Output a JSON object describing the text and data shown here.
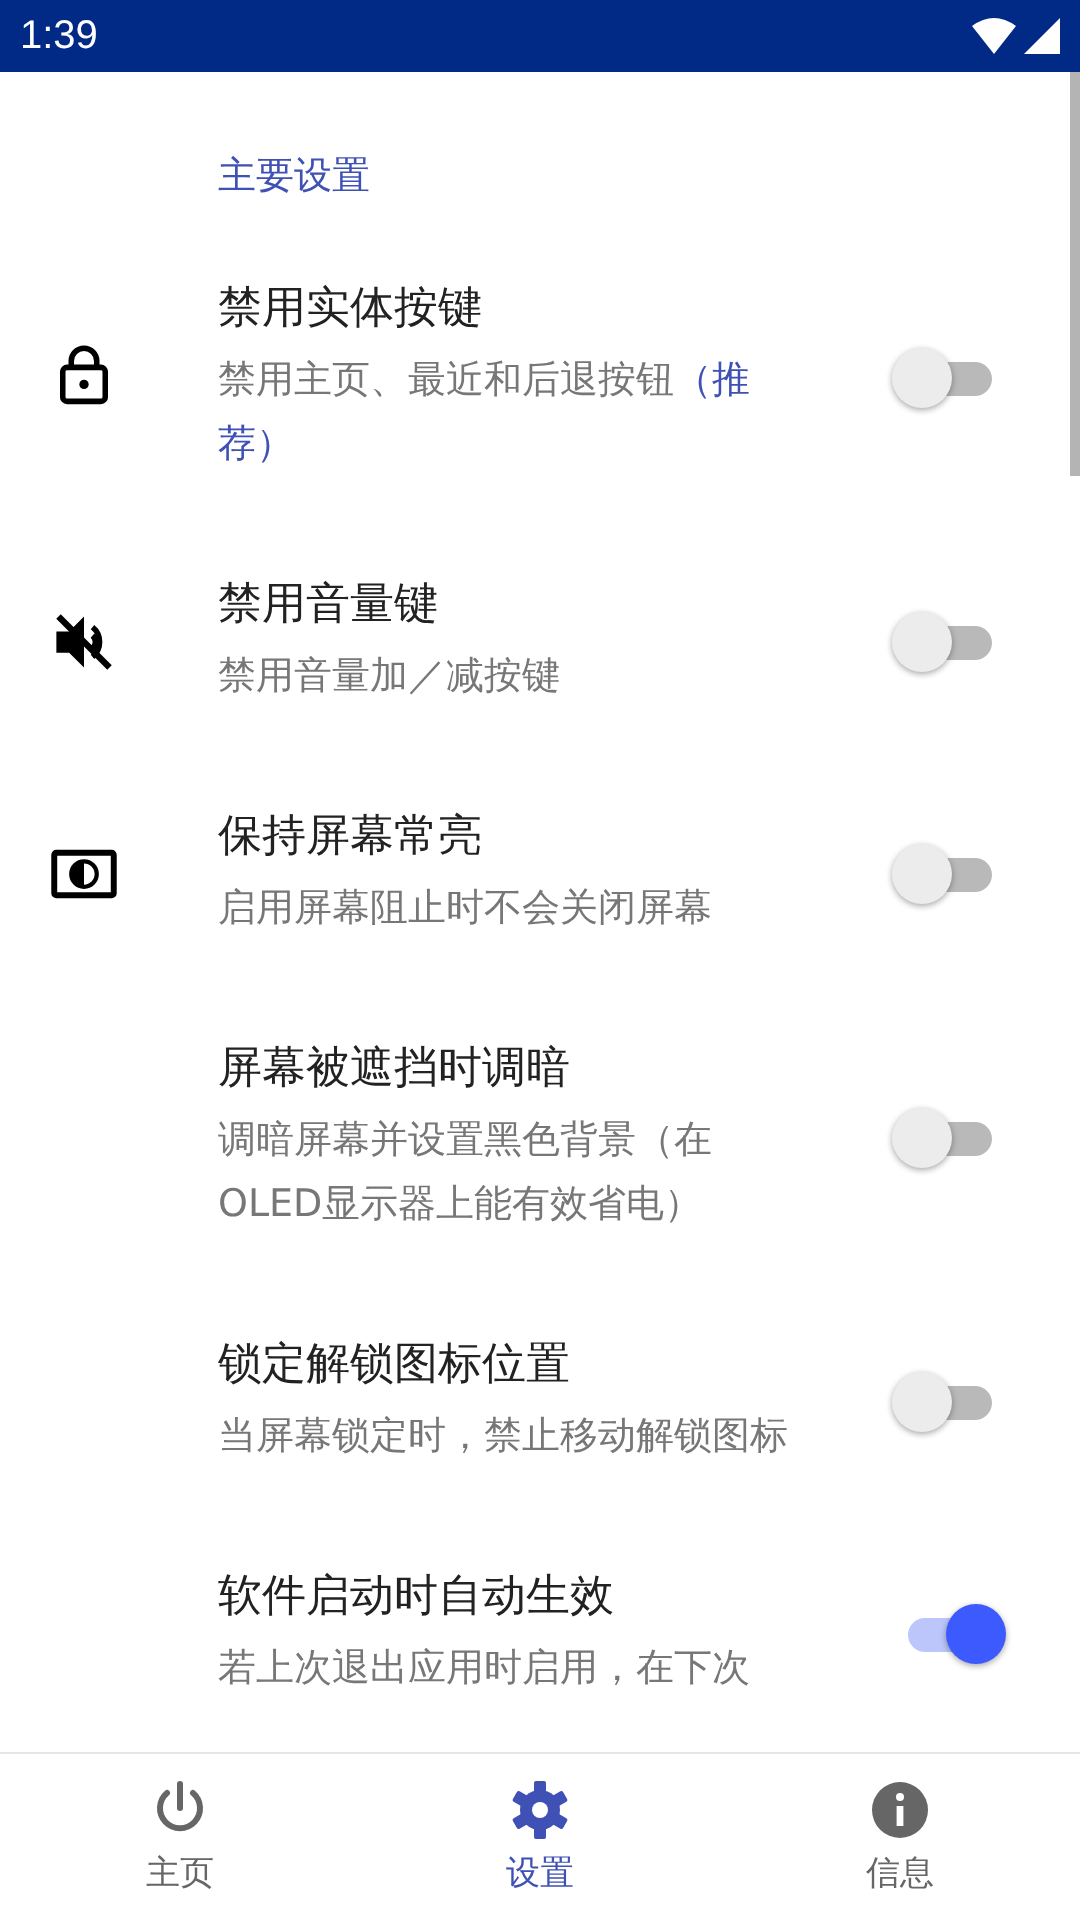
{
  "status_bar": {
    "time": "1:39"
  },
  "section_title": "主要设置",
  "settings": [
    {
      "title": "禁用实体按键",
      "subtitle": "禁用主页、最近和后退按钮",
      "highlight": "（推荐）",
      "on": false
    },
    {
      "title": "禁用音量键",
      "subtitle": "禁用音量加／减按键",
      "on": false
    },
    {
      "title": "保持屏幕常亮",
      "subtitle": "启用屏幕阻止时不会关闭屏幕",
      "on": false
    },
    {
      "title": "屏幕被遮挡时调暗",
      "subtitle": "调暗屏幕并设置黑色背景（在OLED显示器上能有效省电）",
      "on": false
    },
    {
      "title": "锁定解锁图标位置",
      "subtitle": "当屏幕锁定时，禁止移动解锁图标",
      "on": false
    },
    {
      "title": "软件启动时自动生效",
      "subtitle": "若上次退出应用时启用，在下次",
      "on": true
    }
  ],
  "bottom_nav": [
    {
      "label": "主页",
      "selected": false
    },
    {
      "label": "设置",
      "selected": true
    },
    {
      "label": "信息",
      "selected": false
    }
  ]
}
